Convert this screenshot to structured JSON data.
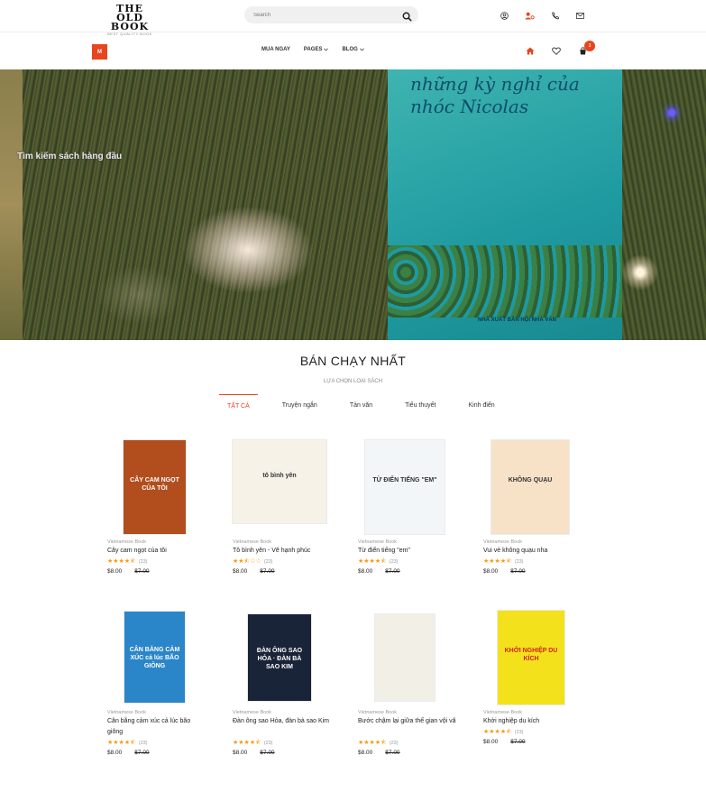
{
  "header": {
    "logo_line1": "THE OLD",
    "logo_line2": "BOOK",
    "logo_tagline": "BEST QUALITY BOOK",
    "search_placeholder": "Search"
  },
  "nav": {
    "logo_letter": "M",
    "items": [
      {
        "label": "MUA NGAY"
      },
      {
        "label": "PAGES",
        "dropdown": true
      },
      {
        "label": "BLOG",
        "dropdown": true
      }
    ],
    "cart_count": "3"
  },
  "hero": {
    "caption": "Tìm kiếm sách hàng đầu",
    "book_title": "những kỳ nghỉ của nhóc Nicolas",
    "publisher": "NHÀ XUẤT BẢN HỘI NHÀ VĂN"
  },
  "section": {
    "title": "BÁN CHẠY NHẤT",
    "subtitle": "LỰA CHỌN LOẠI SÁCH",
    "tabs": [
      "TẤT CẢ",
      "Truyện ngắn",
      "Tản văn",
      "Tiểu thuyết",
      "Kinh điển"
    ],
    "active_tab": 0
  },
  "products": [
    {
      "category": "Vietnamese Book",
      "name": "Cây cam ngọt của tôi",
      "rating": 4.5,
      "reviews": "(23)",
      "price": "$8.00",
      "old_price": "$7.00",
      "cover_text": "CÂY CAM NGỌT CỦA TÔI",
      "cover_color": "#b24d1e"
    },
    {
      "category": "Vietnamese Book",
      "name": "Tô bình yên - Vẽ hạnh phúc",
      "rating": 2.5,
      "reviews": "(23)",
      "price": "$8.00",
      "old_price": "$7.00",
      "cover_text": "tô bình yên",
      "cover_color": "#f6f2e8"
    },
    {
      "category": "Vietnamese Book",
      "name": "Từ điển tiếng \"em\"",
      "rating": 4.5,
      "reviews": "(23)",
      "price": "$8.00",
      "old_price": "$7.00",
      "cover_text": "TỪ ĐIỂN TIẾNG \"EM\"",
      "cover_color": "#f3f6f8"
    },
    {
      "category": "Vietnamese Book",
      "name": "Vui vẻ không quạu nha",
      "rating": 4.5,
      "reviews": "(23)",
      "price": "$8.00",
      "old_price": "$7.00",
      "cover_text": "KHÔNG QUẠU",
      "cover_color": "#f7e2c8"
    },
    {
      "category": "Vietnamese Book",
      "name": "Cân bằng cảm xúc cả lúc bão giông",
      "rating": 4.5,
      "reviews": "(23)",
      "price": "$8.00",
      "old_price": "$7.00",
      "cover_text": "CÂN BẰNG CẢM XÚC cả lúc BÃO GIÔNG",
      "cover_color": "#2a86c8"
    },
    {
      "category": "Vietnamese Book",
      "name": "Đàn ông sao Hỏa, đàn bà sao Kim",
      "rating": 4.5,
      "reviews": "(23)",
      "price": "$8.00",
      "old_price": "$7.00",
      "cover_text": "ĐÀN ÔNG SAO HỎA · ĐÀN BÀ SAO KIM",
      "cover_color": "#1a2438"
    },
    {
      "category": "Vietnamese Book",
      "name": "Bước chậm lại giữa thế gian vội vã",
      "rating": 4.5,
      "reviews": "(23)",
      "price": "$8.00",
      "old_price": "$7.00",
      "cover_text": "",
      "cover_color": "#f2efe6"
    },
    {
      "category": "Vietnamese Book",
      "name": "Khởi nghiệp du kích",
      "rating": 4.5,
      "reviews": "(23)",
      "price": "$8.00",
      "old_price": "$7.00",
      "cover_text": "KHỞI NGHIỆP DU KÍCH",
      "cover_color": "#f3e21b"
    }
  ]
}
